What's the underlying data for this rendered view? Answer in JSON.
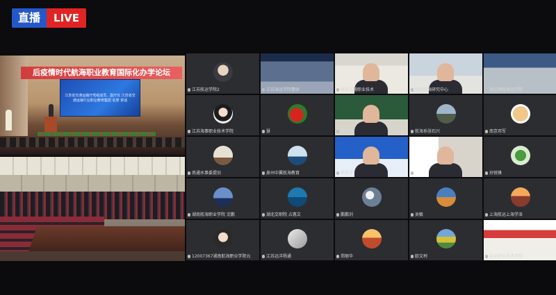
{
  "live_badge": {
    "zh": "直播",
    "en": "LIVE"
  },
  "venue": {
    "banner": "后疫情时代航海职业教育国际化办学论坛",
    "screen_text": "江苏省交通运输厅党组成员、副厅长 江苏省交通运输行业职业教育集团 名誉 讲话"
  },
  "tiles": [
    {
      "row": 0,
      "col": 0,
      "name": "江苏航运学院2",
      "kind": "avatar",
      "avatar": "person-photo-icon"
    },
    {
      "row": 0,
      "col": 1,
      "name": "江苏海运学院曹妍",
      "kind": "video",
      "scene": "screen-share"
    },
    {
      "row": 0,
      "col": 2,
      "name": "南京交通职业技术",
      "kind": "video",
      "scene": "speaker-bookshelf"
    },
    {
      "row": 0,
      "col": 3,
      "name": "中国航海研究中心",
      "kind": "video",
      "scene": "office-man"
    },
    {
      "row": 0,
      "col": 4,
      "name": "浙江国际海运学院",
      "kind": "video",
      "scene": "classroom"
    },
    {
      "row": 1,
      "col": 0,
      "name": "江苏海事职业技术学院",
      "kind": "avatar",
      "avatar": "woman-photo-icon"
    },
    {
      "row": 1,
      "col": 1,
      "name": "慧",
      "kind": "avatar",
      "avatar": "strawberry-icon"
    },
    {
      "row": 1,
      "col": 2,
      "name": "施正勇",
      "kind": "video",
      "scene": "blackboard-man",
      "highlight": true
    },
    {
      "row": 1,
      "col": 3,
      "name": "航海系张石兴",
      "kind": "avatar",
      "avatar": "landscape-icon"
    },
    {
      "row": 1,
      "col": 4,
      "name": "南京邓军",
      "kind": "avatar",
      "avatar": "cartoon-icon"
    },
    {
      "row": 2,
      "col": 0,
      "name": "南通水事委提旧",
      "kind": "avatar",
      "avatar": "sign-icon"
    },
    {
      "row": 2,
      "col": 1,
      "name": "泉州中翼航海教育",
      "kind": "avatar",
      "avatar": "ship-icon"
    },
    {
      "row": 2,
      "col": 2,
      "name": "韩晋东",
      "kind": "video",
      "scene": "forum-slide"
    },
    {
      "row": 2,
      "col": 3,
      "name": "",
      "kind": "video",
      "scene": "man-door"
    },
    {
      "row": 2,
      "col": 4,
      "name": "孙锐锋",
      "kind": "avatar",
      "avatar": "plant-icon"
    },
    {
      "row": 3,
      "col": 0,
      "name": "湖南航海职业学院 沈鹏",
      "kind": "avatar",
      "avatar": "seaside-icon"
    },
    {
      "row": 3,
      "col": 1,
      "name": "湖北交职院 占惠文",
      "kind": "avatar",
      "avatar": "ocean-icon"
    },
    {
      "row": 3,
      "col": 2,
      "name": "鹏鹏刘",
      "kind": "avatar",
      "avatar": "moon-icon"
    },
    {
      "row": 3,
      "col": 3,
      "name": "吴敏",
      "kind": "avatar",
      "avatar": "city-icon"
    },
    {
      "row": 3,
      "col": 4,
      "name": "上海航运上海学泽",
      "kind": "avatar",
      "avatar": "sunset-icon"
    },
    {
      "row": 4,
      "col": 0,
      "name": "12007367湖南航海职业学院元",
      "kind": "avatar",
      "avatar": "woman2-photo-icon"
    },
    {
      "row": 4,
      "col": 1,
      "name": "江苏远洋杨通",
      "kind": "avatar",
      "avatar": "sketch-icon"
    },
    {
      "row": 4,
      "col": 2,
      "name": "郑丽华",
      "kind": "avatar",
      "avatar": "sunset2-icon"
    },
    {
      "row": 4,
      "col": 3,
      "name": "欧文柯",
      "kind": "avatar",
      "avatar": "field-icon"
    },
    {
      "row": 4,
      "col": 4,
      "name": "延安职业技术学院",
      "kind": "video",
      "scene": "red-banner-office"
    }
  ]
}
